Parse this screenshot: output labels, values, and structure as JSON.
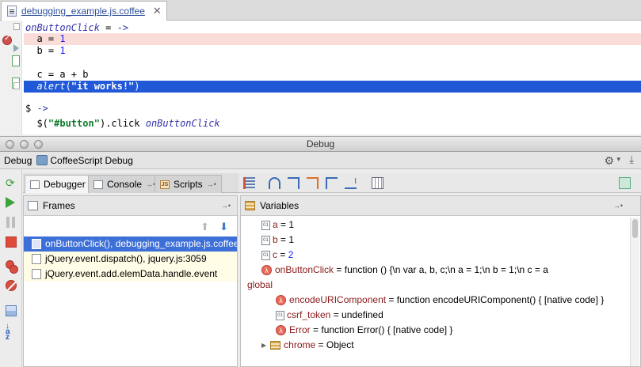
{
  "editor": {
    "tab": {
      "filename": "debugging_example.js.coffee",
      "close_glyph": "✕"
    },
    "code_lines": [
      [
        {
          "t": "onButtonClick",
          "c": "fn"
        },
        {
          "t": " = ",
          "c": ""
        },
        {
          "t": "->",
          "c": "arrow"
        }
      ],
      [
        {
          "t": "  a = ",
          "c": ""
        },
        {
          "t": "1",
          "c": "num"
        }
      ],
      [
        {
          "t": "  b = ",
          "c": ""
        },
        {
          "t": "1",
          "c": "num"
        }
      ],
      [
        {
          "t": "",
          "c": ""
        }
      ],
      [
        {
          "t": "  c = a + b",
          "c": ""
        }
      ],
      [
        {
          "t": "  ",
          "c": ""
        },
        {
          "t": "alert",
          "c": "fn"
        },
        {
          "t": "(",
          "c": ""
        },
        {
          "t": "\"it works!\"",
          "c": "str"
        },
        {
          "t": ")",
          "c": ""
        }
      ],
      [
        {
          "t": "",
          "c": ""
        }
      ],
      [
        {
          "t": "$ ",
          "c": ""
        },
        {
          "t": "->",
          "c": "arrow"
        }
      ],
      [
        {
          "t": "  $(",
          "c": ""
        },
        {
          "t": "\"#button\"",
          "c": "str"
        },
        {
          "t": ").click ",
          "c": ""
        },
        {
          "t": "onButtonClick",
          "c": "fn"
        }
      ]
    ]
  },
  "debug_window": {
    "title": "Debug",
    "header_label": "Debug",
    "config_name": "CoffeeScript Debug"
  },
  "sub_tabs": [
    {
      "label": "Debugger",
      "active": true,
      "icon": "debugger-icon"
    },
    {
      "label": "Console",
      "active": false,
      "icon": "console-icon"
    },
    {
      "label": "Scripts",
      "active": false,
      "icon": "scripts-icon"
    }
  ],
  "frames": {
    "title": "Frames",
    "items": [
      {
        "label": "onButtonClick(), debugging_example.js.coffee",
        "selected": true
      },
      {
        "label": "jQuery.event.dispatch(), jquery.js:3059",
        "selected": false
      },
      {
        "label": "jQuery.event.add.elemData.handle.event",
        "selected": false
      }
    ]
  },
  "variables": {
    "title": "Variables",
    "rows": [
      {
        "indent": 0,
        "icon": "primitive",
        "name": "a",
        "value": "1",
        "numeric": true
      },
      {
        "indent": 0,
        "icon": "primitive",
        "name": "b",
        "value": "1",
        "numeric": true
      },
      {
        "indent": 0,
        "icon": "primitive",
        "name": "c",
        "value": "2",
        "numeric": true
      },
      {
        "indent": 0,
        "icon": "function",
        "name": "onButtonClick",
        "value": "function () {\\n    var a, b, c;\\n    a = 1;\\n    b = 1;\\n    c = a",
        "numeric": false
      },
      {
        "indent": 0,
        "icon": "group",
        "name": "global",
        "value": "",
        "numeric": false
      },
      {
        "indent": 1,
        "icon": "function",
        "name": "encodeURIComponent",
        "value": "function encodeURIComponent() { [native code] }",
        "numeric": false
      },
      {
        "indent": 1,
        "icon": "primitive",
        "name": "csrf_token",
        "value": "undefined",
        "numeric": false
      },
      {
        "indent": 1,
        "icon": "function",
        "name": "Error",
        "value": "function Error() { [native code] }",
        "numeric": false
      },
      {
        "indent": 1,
        "icon": "object",
        "name": "chrome",
        "value": "Object",
        "numeric": false
      }
    ]
  },
  "colors": {
    "selection_blue": "#2058d8",
    "breakpoint_line": "#fadcd9",
    "frame_selected": "#3d6fd8"
  }
}
